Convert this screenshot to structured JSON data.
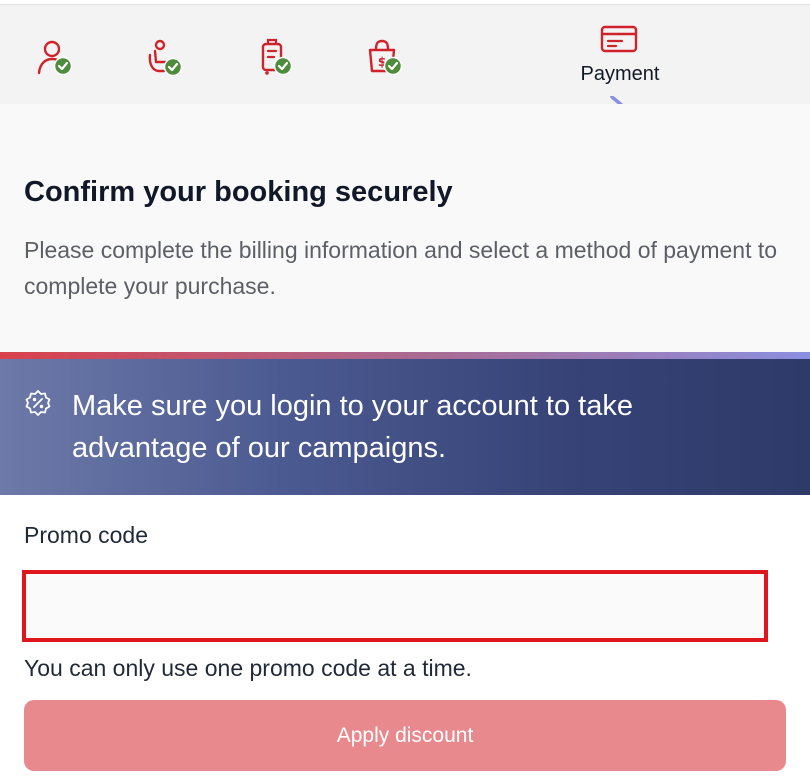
{
  "stepper": {
    "steps": [
      {
        "icon": "user-icon",
        "status": "complete"
      },
      {
        "icon": "seat-icon",
        "status": "complete"
      },
      {
        "icon": "luggage-icon",
        "status": "complete"
      },
      {
        "icon": "shopping-bag-icon",
        "status": "complete"
      },
      {
        "icon": "credit-card-icon",
        "status": "current",
        "label": "Payment"
      }
    ],
    "check_color": "#4f8b3c",
    "icon_color": "#d0222b"
  },
  "intro": {
    "title": "Confirm your booking securely",
    "subtitle": "Please complete the billing information and select a method of payment to complete your purchase."
  },
  "banner": {
    "icon": "discount-badge-icon",
    "text": "Make sure you login to your account to take advantage of our campaigns."
  },
  "promo": {
    "label": "Promo code",
    "value": "",
    "note": "You can only use one promo code at a time.",
    "apply_label": "Apply discount"
  },
  "colors": {
    "accent": "#e0161e",
    "button_disabled": "#e88a8d",
    "banner_dark": "#2e3a68"
  }
}
